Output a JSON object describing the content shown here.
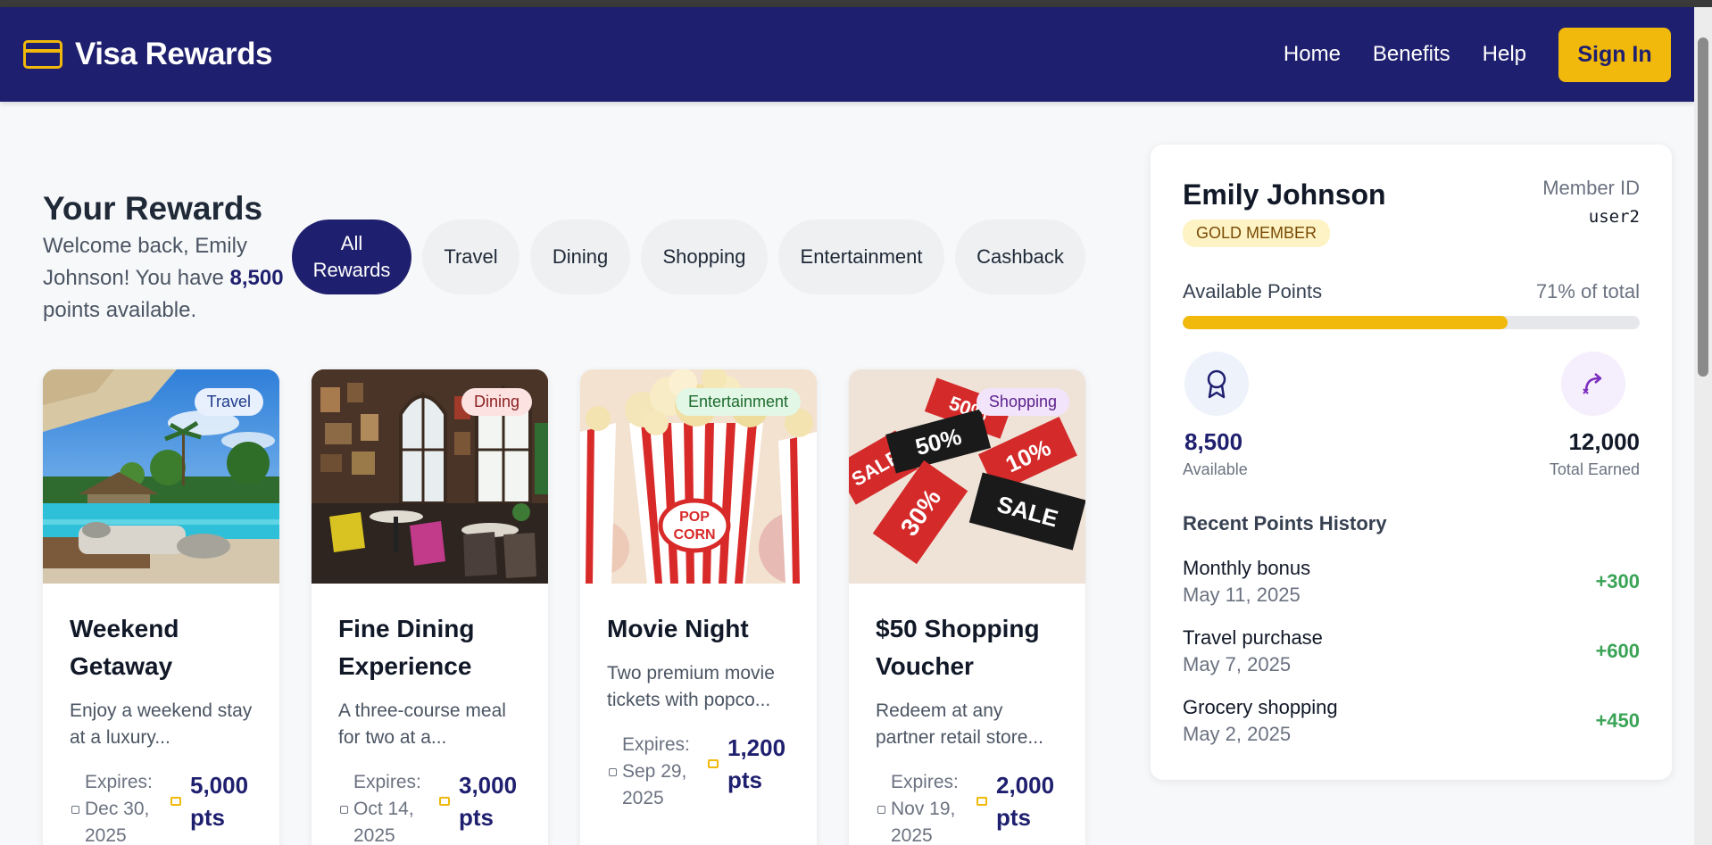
{
  "header": {
    "brand": "Visa Rewards",
    "nav": [
      "Home",
      "Benefits",
      "Help"
    ],
    "signin": "Sign In"
  },
  "main": {
    "title": "Your Rewards",
    "welcome_prefix": "Welcome back, Emily Johnson! You have",
    "points": "8,500",
    "welcome_suffix": "points available.",
    "filters": [
      "All Rewards",
      "Travel",
      "Dining",
      "Shopping",
      "Entertainment",
      "Cashback"
    ],
    "cards": [
      {
        "category": "Travel",
        "title": "Weekend Getaway",
        "desc": "Enjoy a weekend stay at a luxury...",
        "expires_label": "Expires:",
        "expires": "Dec 30, 2025",
        "points": "5,000",
        "pts_label": "pts"
      },
      {
        "category": "Dining",
        "title": "Fine Dining Experience",
        "desc": "A three-course meal for two at a...",
        "expires_label": "Expires:",
        "expires": "Oct 14, 2025",
        "points": "3,000",
        "pts_label": "pts"
      },
      {
        "category": "Entertainment",
        "title": "Movie Night",
        "desc": "Two premium movie tickets with popco...",
        "expires_label": "Expires:",
        "expires": "Sep 29, 2025",
        "points": "1,200",
        "pts_label": "pts"
      },
      {
        "category": "Shopping",
        "title": "$50 Shopping Voucher",
        "desc": "Redeem at any partner retail store...",
        "expires_label": "Expires:",
        "expires": "Nov 19, 2025",
        "points": "2,000",
        "pts_label": "pts"
      }
    ]
  },
  "profile": {
    "name": "Emily Johnson",
    "tier": "GOLD MEMBER",
    "member_id_label": "Member ID",
    "member_id": "user2",
    "available_label": "Available Points",
    "percent_label": "71% of total",
    "percent": 0.71,
    "available": "8,500",
    "available_stat_label": "Available",
    "total": "12,000",
    "total_stat_label": "Total Earned",
    "history_title": "Recent Points History",
    "history": [
      {
        "name": "Monthly bonus",
        "date": "May 11, 2025",
        "points": "+300"
      },
      {
        "name": "Travel purchase",
        "date": "May 7, 2025",
        "points": "+600"
      },
      {
        "name": "Grocery shopping",
        "date": "May 2, 2025",
        "points": "+450"
      }
    ]
  },
  "colors": {
    "navy": "#1f1f6f",
    "gold": "#f0b90b",
    "positive": "#3aa356"
  }
}
